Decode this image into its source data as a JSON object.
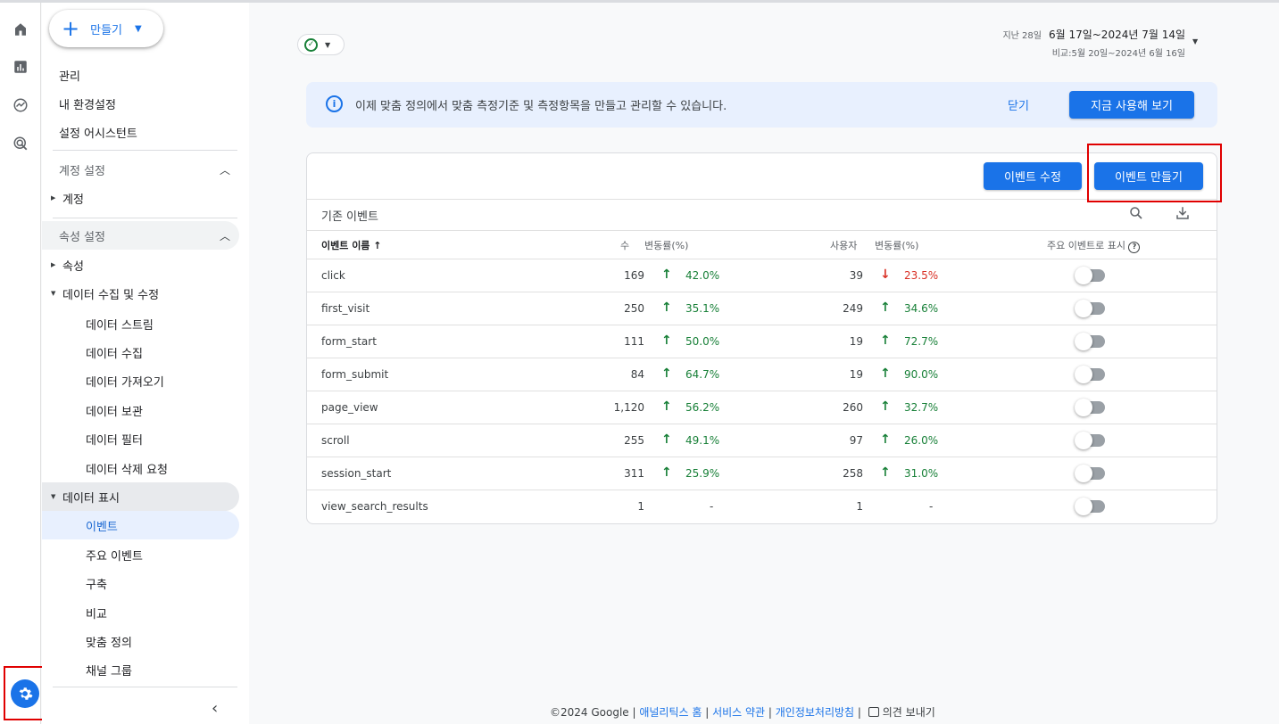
{
  "create_label": "만들기",
  "top_links": [
    "관리",
    "내 환경설정",
    "설정 어시스턴트"
  ],
  "account_section": {
    "title": "계정 설정",
    "item": "계정"
  },
  "property_section": {
    "title": "속성 설정",
    "property": "속성",
    "data_collection": "데이터 수집 및 수정",
    "data_collection_items": [
      "데이터 스트림",
      "데이터 수집",
      "데이터 가져오기",
      "데이터 보관",
      "데이터 필터",
      "데이터 삭제 요청"
    ],
    "data_display": "데이터 표시",
    "data_display_items": [
      "이벤트",
      "주요 이벤트",
      "구축",
      "비교",
      "맞춤 정의",
      "채널 그룹"
    ]
  },
  "date": {
    "prefix": "지난 28일",
    "range": "6월 17일~2024년 7월 14일",
    "compare": "비교:5월 20일~2024년 6월 16일"
  },
  "banner": {
    "text": "이제 맞춤 정의에서 맞춤 측정기준 및 측정항목을 만들고 관리할 수 있습니다.",
    "close": "닫기",
    "action": "지금 사용해 보기"
  },
  "buttons": {
    "edit_event": "이벤트 수정",
    "create_event": "이벤트 만들기"
  },
  "table": {
    "title": "기존 이벤트",
    "headers": {
      "name": "이벤트 이름",
      "count": "수",
      "count_change": "변동률(%)",
      "users": "사용자",
      "users_change": "변동률(%)",
      "mark_key": "주요 이벤트로 표시"
    },
    "rows": [
      {
        "name": "click",
        "count": "169",
        "count_change": "42.0%",
        "count_dir": "up",
        "users": "39",
        "users_change": "23.5%",
        "users_dir": "down"
      },
      {
        "name": "first_visit",
        "count": "250",
        "count_change": "35.1%",
        "count_dir": "up",
        "users": "249",
        "users_change": "34.6%",
        "users_dir": "up"
      },
      {
        "name": "form_start",
        "count": "111",
        "count_change": "50.0%",
        "count_dir": "up",
        "users": "19",
        "users_change": "72.7%",
        "users_dir": "up"
      },
      {
        "name": "form_submit",
        "count": "84",
        "count_change": "64.7%",
        "count_dir": "up",
        "users": "19",
        "users_change": "90.0%",
        "users_dir": "up"
      },
      {
        "name": "page_view",
        "count": "1,120",
        "count_change": "56.2%",
        "count_dir": "up",
        "users": "260",
        "users_change": "32.7%",
        "users_dir": "up"
      },
      {
        "name": "scroll",
        "count": "255",
        "count_change": "49.1%",
        "count_dir": "up",
        "users": "97",
        "users_change": "26.0%",
        "users_dir": "up"
      },
      {
        "name": "session_start",
        "count": "311",
        "count_change": "25.9%",
        "count_dir": "up",
        "users": "258",
        "users_change": "31.0%",
        "users_dir": "up"
      },
      {
        "name": "view_search_results",
        "count": "1",
        "count_change": "-",
        "count_dir": "none",
        "users": "1",
        "users_change": "-",
        "users_dir": "none"
      }
    ]
  },
  "footer": {
    "copyright": "©2024 Google",
    "home": "애널리틱스 홈",
    "terms": "서비스 약관",
    "privacy": "개인정보처리방침",
    "feedback": "의견 보내기"
  },
  "colors": {
    "accent": "#1a73e8",
    "positive": "#188038",
    "negative": "#d93025",
    "highlight": "#e00000"
  }
}
